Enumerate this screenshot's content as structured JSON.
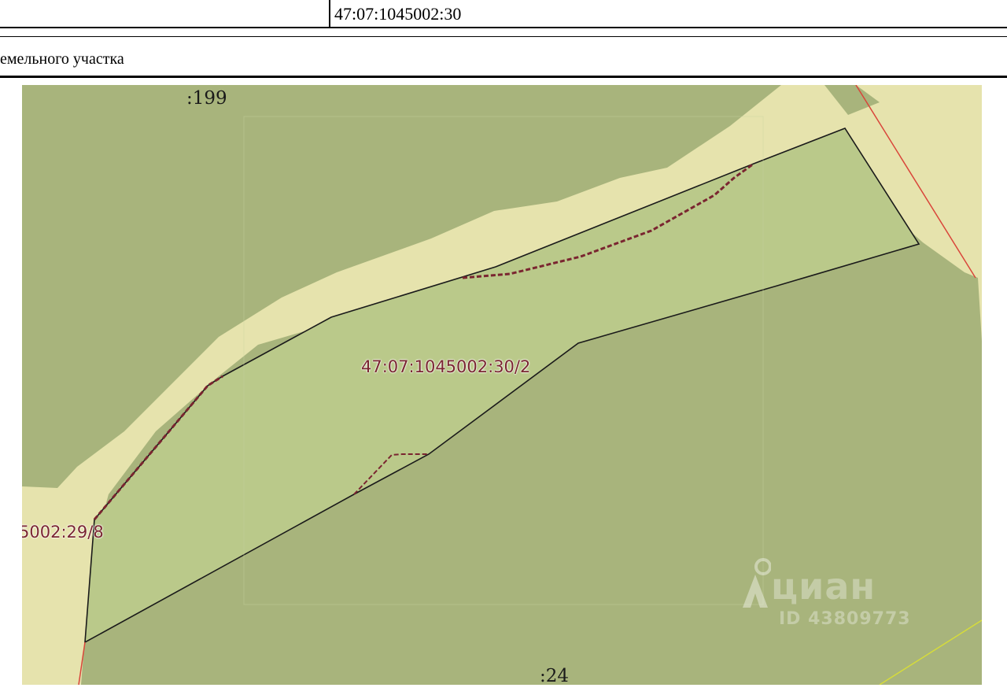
{
  "header": {
    "cadastral_number": "47:07:1045002:30"
  },
  "section": {
    "title": "емельного участка"
  },
  "map": {
    "labels": {
      "top_parcel": ":199",
      "bottom_parcel": ":24",
      "main_parcel": "47:07:1045002:30/2",
      "neighbor_parcel": "5002:29/8"
    },
    "colors": {
      "dark_land": "#a8b47c",
      "light_parcel": "#bac98a",
      "road_strip": "#e6e3ad",
      "boundary": "#1a1a1a",
      "red_line": "#d9453a",
      "yellow_line": "#d6dc3a"
    },
    "watermark": {
      "brand": "циан",
      "id": "ID 43809773",
      "icon": "location-pin-icon"
    }
  }
}
